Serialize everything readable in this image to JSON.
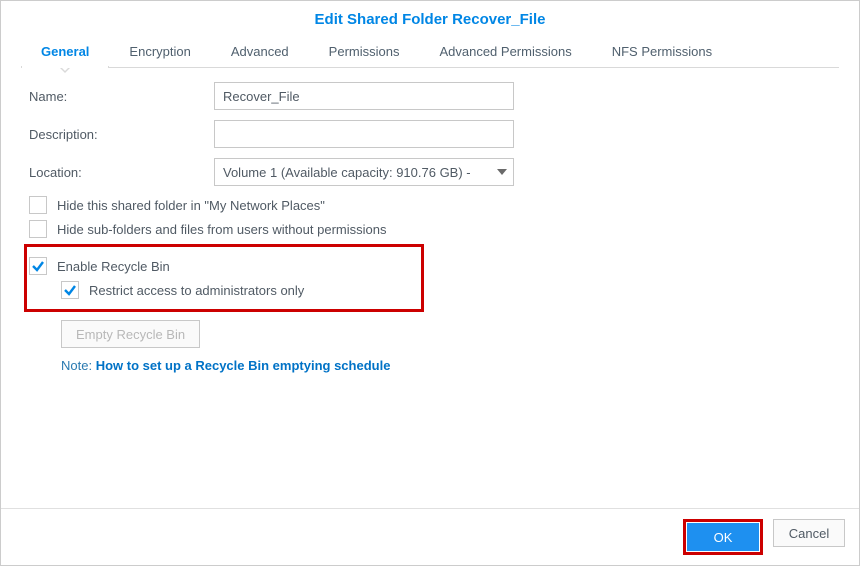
{
  "title": "Edit Shared Folder Recover_File",
  "tabs": [
    {
      "label": "General"
    },
    {
      "label": "Encryption"
    },
    {
      "label": "Advanced"
    },
    {
      "label": "Permissions"
    },
    {
      "label": "Advanced Permissions"
    },
    {
      "label": "NFS Permissions"
    }
  ],
  "activeTab": 0,
  "form": {
    "name_label": "Name:",
    "name_value": "Recover_File",
    "description_label": "Description:",
    "description_value": "",
    "location_label": "Location:",
    "location_value": "Volume 1 (Available capacity: 910.76 GB) -"
  },
  "checks": {
    "hide_network": {
      "checked": false,
      "label": "Hide this shared folder in \"My Network Places\""
    },
    "hide_subfolders": {
      "checked": false,
      "label": "Hide sub-folders and files from users without permissions"
    },
    "enable_recycle": {
      "checked": true,
      "label": "Enable Recycle Bin"
    },
    "restrict_admin": {
      "checked": true,
      "label": "Restrict access to administrators only"
    }
  },
  "buttons": {
    "empty_recycle": "Empty Recycle Bin",
    "ok": "OK",
    "cancel": "Cancel"
  },
  "note": {
    "prefix": "Note: ",
    "link": "How to set up a Recycle Bin emptying schedule"
  }
}
